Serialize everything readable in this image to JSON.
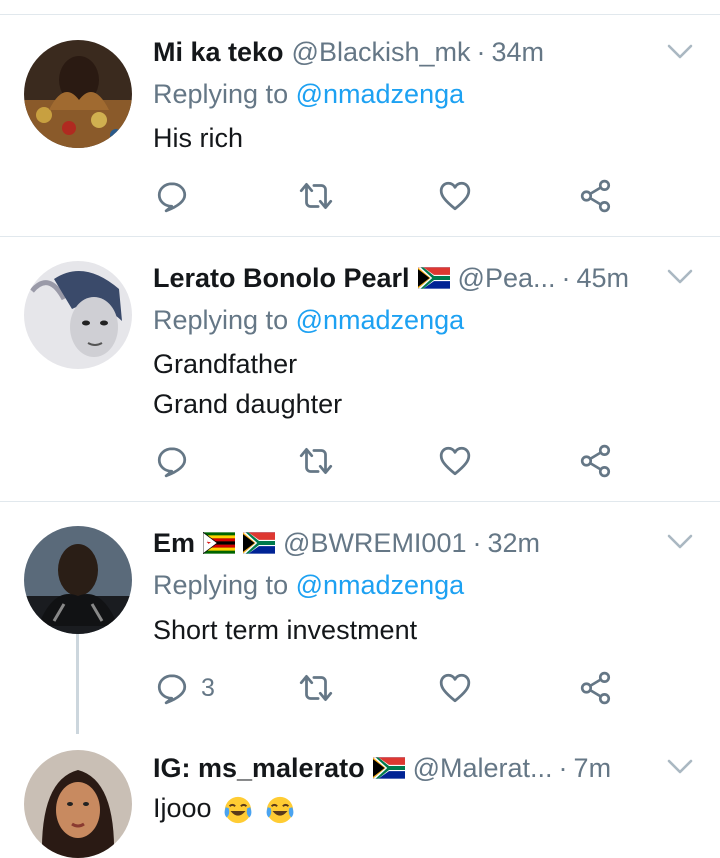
{
  "tweets": [
    {
      "name": "Mi ka teko",
      "handle": "@Blackish_mk",
      "time": "34m",
      "replying_prefix": "Replying to",
      "replying_to": "@nmadzenga",
      "body": [
        "His rich"
      ],
      "reply_count": ""
    },
    {
      "name": "Lerato Bonolo Pearl",
      "handle": "@Pea...",
      "time": "45m",
      "replying_prefix": "Replying to",
      "replying_to": "@nmadzenga",
      "body": [
        "Grandfather",
        "Grand daughter"
      ],
      "reply_count": ""
    },
    {
      "name": "Em",
      "handle": "@BWREMI001",
      "time": "32m",
      "replying_prefix": "Replying to",
      "replying_to": "@nmadzenga",
      "body": [
        "Short term investment"
      ],
      "reply_count": "3"
    },
    {
      "name": "IG: ms_malerato",
      "handle": "@Malerat...",
      "time": "7m",
      "body": [
        "Ijooo"
      ]
    }
  ],
  "icons": {
    "reply": "reply-bubble-icon",
    "retweet": "retweet-icon",
    "like": "heart-icon",
    "share": "share-icon",
    "caret": "chevron-down-icon",
    "flag_za": "south-africa-flag",
    "flag_zw": "zimbabwe-flag",
    "emoji": "face-with-tears-of-joy"
  },
  "colors": {
    "text_primary": "#14171a",
    "text_secondary": "#657786",
    "link": "#1da1f2",
    "divider": "#e1e8ed",
    "thread_line": "#ccd6dd"
  }
}
